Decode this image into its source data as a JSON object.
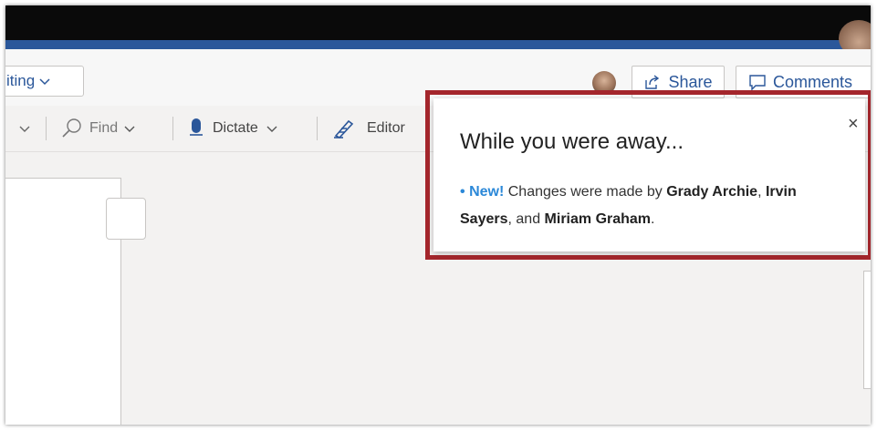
{
  "ribbon": {
    "editing_label": "iting",
    "share_label": "Share",
    "comments_label": "Comments"
  },
  "toolbar": {
    "find_label": "Find",
    "dictate_label": "Dictate",
    "editor_label": "Editor"
  },
  "popup": {
    "title": "While you were away...",
    "close_glyph": "×",
    "bullet": "•",
    "new_label": "New!",
    "message_prefix": "Changes were made by",
    "user1": "Grady Archie",
    "separator1": ",",
    "user2": "Irvin Sayers",
    "separator2": ", and",
    "user3": "Miriam Graham",
    "message_suffix": "."
  },
  "colors": {
    "accent_blue": "#2b579a",
    "link_blue": "#2b88d8",
    "highlight_red": "#a4262c",
    "titlebar": "#0a0a0a"
  }
}
